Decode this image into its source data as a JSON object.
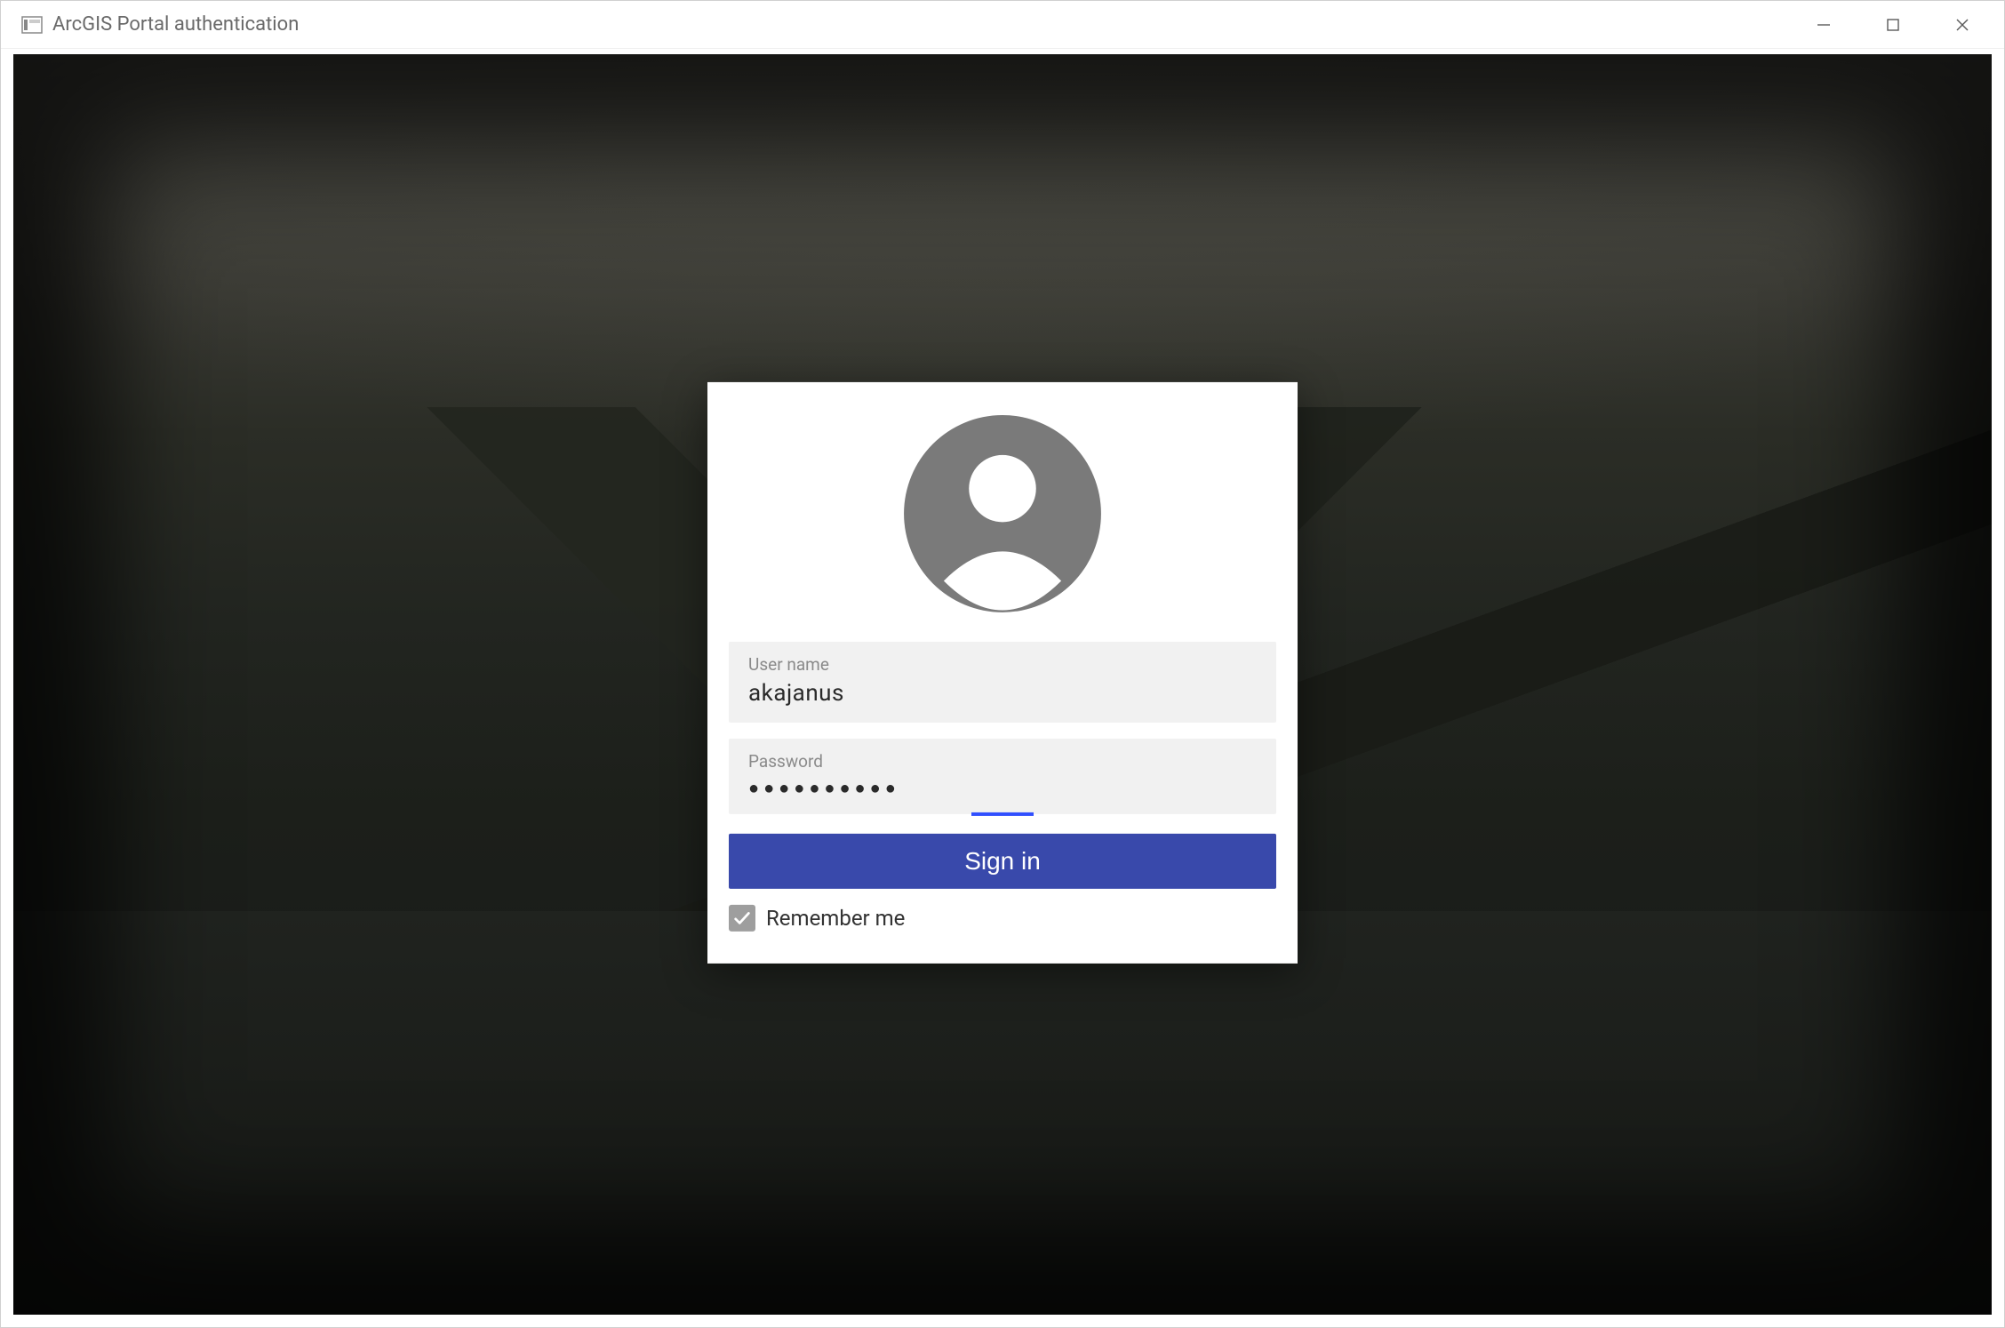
{
  "window": {
    "title": "ArcGIS Portal authentication"
  },
  "login": {
    "username_label": "User name",
    "username_value": "akajanus",
    "password_label": "Password",
    "password_value": "●●●●●●●●●●",
    "signin_label": "Sign in",
    "remember_label": "Remember me",
    "remember_checked": true
  },
  "colors": {
    "primary": "#3949ab",
    "focus_underline": "#304ffe",
    "field_bg": "#f1f1f1",
    "checkbox_bg": "#9e9e9e"
  }
}
